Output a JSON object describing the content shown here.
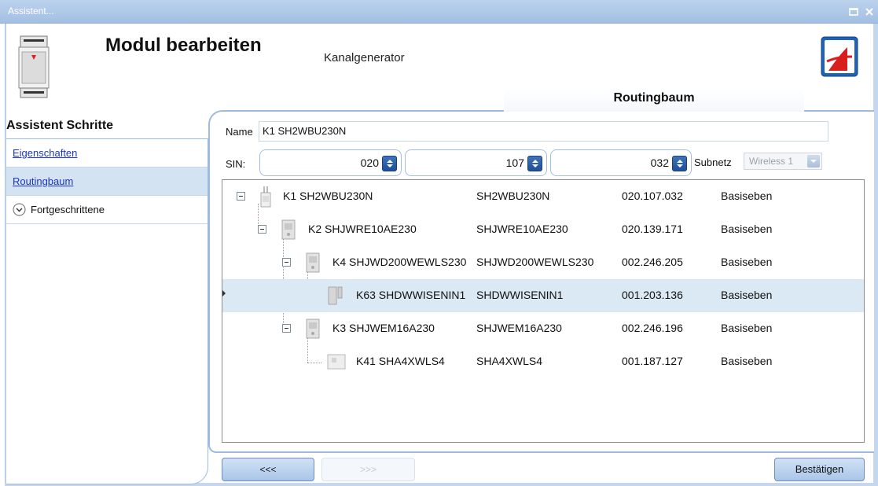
{
  "window": {
    "title": "Assistent..."
  },
  "header": {
    "title": "Modul bearbeiten",
    "subtitle": "Kanalgenerator"
  },
  "steps": {
    "title": "Assistent Schritte",
    "items": [
      {
        "label": "Eigenschaften",
        "type": "link"
      },
      {
        "label": "Routingbaum",
        "type": "link",
        "active": true
      },
      {
        "label": "Fortgeschrittene",
        "type": "expandable"
      }
    ]
  },
  "tab": {
    "label": "Routingbaum"
  },
  "form": {
    "name_label": "Name",
    "name_value": "K1 SH2WBU230N",
    "sin_label": "SIN:",
    "sin_values": [
      "020",
      "107",
      "032"
    ],
    "subnet_label": "Subnetz",
    "subnet_value": "Wireless 1"
  },
  "tree": {
    "rows": [
      {
        "name": "K1 SH2WBU230N",
        "type": "SH2WBU230N",
        "sin": "020.107.032",
        "level": "Basiseben",
        "depth": 0,
        "expandable": true,
        "selected": false
      },
      {
        "name": "K2 SHJWRE10AE230",
        "type": "SHJWRE10AE230",
        "sin": "020.139.171",
        "level": "Basiseben",
        "depth": 1,
        "expandable": true,
        "selected": false
      },
      {
        "name": "K4 SHJWD200WEWLS230",
        "type": "SHJWD200WEWLS230",
        "sin": "002.246.205",
        "level": "Basiseben",
        "depth": 2,
        "expandable": true,
        "selected": false
      },
      {
        "name": "K63 SHDWWISENIN1",
        "type": "SHDWWISENIN1",
        "sin": "001.203.136",
        "level": "Basiseben",
        "depth": 3,
        "expandable": false,
        "selected": true
      },
      {
        "name": "K3 SHJWEM16A230",
        "type": "SHJWEM16A230",
        "sin": "002.246.196",
        "level": "Basiseben",
        "depth": 2,
        "expandable": true,
        "selected": false
      },
      {
        "name": "K41 SHA4XWLS4",
        "type": "SHA4XWLS4",
        "sin": "001.187.127",
        "level": "Basiseben",
        "depth": 3,
        "expandable": false,
        "selected": false
      }
    ]
  },
  "buttons": {
    "back": "<<<",
    "next": ">>>",
    "confirm": "Bestätigen"
  },
  "colors": {
    "accent": "#1f4f97",
    "selection": "#dae9f3",
    "panel_border": "#9dbbe0",
    "link": "#1a37c0"
  },
  "icons": {
    "window_max": "maximize-icon",
    "window_close": "close-icon",
    "module": "module-device-icon",
    "logo": "app-logo-icon"
  }
}
